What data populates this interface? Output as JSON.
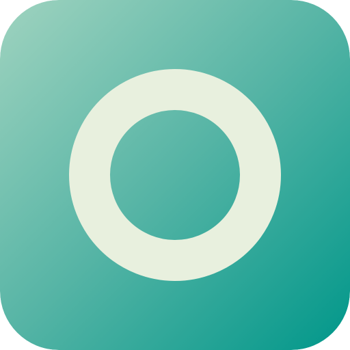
{
  "icon": {
    "name": "ring-icon",
    "shape": "rounded-square",
    "colors": {
      "gradient_start": "#9fd3bf",
      "gradient_mid": "#55b4a5",
      "gradient_end": "#00978a",
      "ring": "#e8f0de"
    }
  }
}
